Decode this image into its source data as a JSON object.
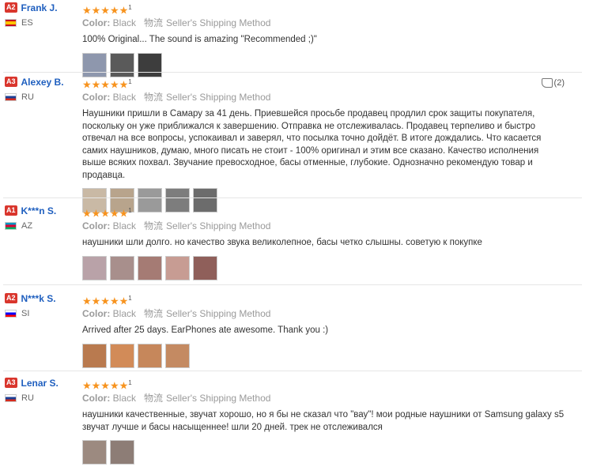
{
  "common": {
    "color_label": "Color:",
    "color_value": "Black",
    "shipping_cn": "物流",
    "shipping_method": "Seller's Shipping Method",
    "stars": "★★★★★",
    "star_suffix": "1"
  },
  "reviews": [
    {
      "badge": "A2",
      "name": "Frank J.",
      "country": "ES",
      "text": "100% Original... The sound is amazing \"Recommended ;)\"",
      "helpful": "",
      "photos": [
        "#8e97ad",
        "#5a5a5a",
        "#3d3d3d"
      ]
    },
    {
      "badge": "A3",
      "name": "Alexey B.",
      "country": "RU",
      "text": "Наушники пришли в Самару за 41 день. Приевшейся просьбе продавец продлил срок защиты покупателя, поскольку он уже приближался к завершению. Отправка не отслеживалась. Продавец терпеливо и быстро отвечал на все вопросы, успокаивал и заверял, что посылка точно дойдёт. В итоге дождались. Что касается самих наушников, думаю, много писать не стоит - 100% оригинал и этим все сказано. Качество исполнения выше всяких похвал. Звучание превосходное, басы отменные, глубокие. Однозначно рекомендую товар и продавца.",
      "helpful": "(2)",
      "photos": [
        "#c9b9a5",
        "#b8a48c",
        "#9a9a9a",
        "#7d7d7d",
        "#6c6c6c"
      ]
    },
    {
      "badge": "A1",
      "name": "K***n S.",
      "country": "AZ",
      "text": "наушники шли долго. но качество звука великолепное, басы четко слышны. советую к покупке",
      "helpful": "",
      "photos": [
        "#b9a2a8",
        "#a88f8c",
        "#a57b74",
        "#c79c93",
        "#8f5f5a"
      ]
    },
    {
      "badge": "A2",
      "name": "N***k S.",
      "country": "SI",
      "text": "Arrived after 25 days. EarPhones ate awesome. Thank you :)",
      "helpful": "",
      "photos": [
        "#b97a4f",
        "#d28b58",
        "#c6875b",
        "#c48a62"
      ]
    },
    {
      "badge": "A3",
      "name": "Lenar S.",
      "country": "RU",
      "text": "наушники качественные, звучат хорошо, но я бы не сказал что \"вау\"! мои родные наушники от Samsung galaxy s5 звучат лучше и басы насыщеннее! шли 20 дней. трек не отслеживался",
      "helpful": "",
      "photos": [
        "#9c8a80",
        "#8d7d76"
      ]
    }
  ]
}
